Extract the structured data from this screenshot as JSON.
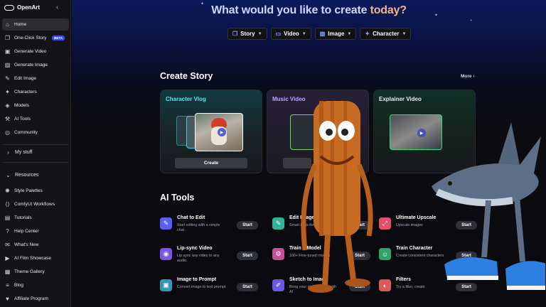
{
  "sidebar": {
    "brand": "OpenArt",
    "items": [
      {
        "label": "Home",
        "icon": "home-icon",
        "glyph": "⌂"
      },
      {
        "label": "One-Click Story",
        "icon": "story-icon",
        "glyph": "❐",
        "badge": "BETA"
      },
      {
        "label": "Generate Video",
        "icon": "video-icon",
        "glyph": "▣"
      },
      {
        "label": "Generate Image",
        "icon": "image-icon",
        "glyph": "▨"
      },
      {
        "label": "Edit Image",
        "icon": "edit-icon",
        "glyph": "✎"
      },
      {
        "label": "Characters",
        "icon": "character-icon",
        "glyph": "✦"
      },
      {
        "label": "Models",
        "icon": "models-icon",
        "glyph": "◈"
      },
      {
        "label": "AI Tools",
        "icon": "tools-icon",
        "glyph": "⚒"
      },
      {
        "label": "Community",
        "icon": "community-icon",
        "glyph": "◎"
      }
    ],
    "my_stuff": "My stuff",
    "resources": "Resources",
    "resource_items": [
      {
        "label": "Style Palettes",
        "icon": "palette-icon",
        "glyph": "✺"
      },
      {
        "label": "ComfyUI Workflows",
        "icon": "code-icon",
        "glyph": "⟨⟩"
      },
      {
        "label": "Tutorials",
        "icon": "tutorials-icon",
        "glyph": "▤"
      },
      {
        "label": "Help Center",
        "icon": "help-icon",
        "glyph": "?"
      },
      {
        "label": "What's New",
        "icon": "megaphone-icon",
        "glyph": "✉"
      },
      {
        "label": "AI Film Showcase",
        "icon": "film-icon",
        "glyph": "▶"
      },
      {
        "label": "Theme Gallery",
        "icon": "gallery-icon",
        "glyph": "▦"
      },
      {
        "label": "Blog",
        "icon": "blog-icon",
        "glyph": "≡"
      },
      {
        "label": "Affiliate Program",
        "icon": "affiliate-icon",
        "glyph": "♥"
      }
    ]
  },
  "header": {
    "headline_part1": "What would you like to create",
    "headline_part2": "today?",
    "filters": [
      {
        "label": "Story",
        "icon": "story-filter-icon",
        "glyph": "❐"
      },
      {
        "label": "Video",
        "icon": "video-filter-icon",
        "glyph": "▭"
      },
      {
        "label": "Image",
        "icon": "image-filter-icon",
        "glyph": "▨"
      },
      {
        "label": "Character",
        "icon": "character-filter-icon",
        "glyph": "✦"
      }
    ]
  },
  "create_story": {
    "title": "Create Story",
    "more": "More ›",
    "cards": [
      {
        "title": "Character Vlog",
        "title_color": "#5fe3f0",
        "button": "Create",
        "bg": "#1a2a30"
      },
      {
        "title": "Music Video",
        "title_color": "#b9a6ff",
        "button": "",
        "bg": "#1c1a28"
      },
      {
        "title": "Explainer Video",
        "title_color": "#e8e8ec",
        "button": "",
        "bg": "#132420"
      }
    ]
  },
  "ai_tools": {
    "title": "AI Tools",
    "start_label": "Start",
    "tools": [
      {
        "name": "Chat to Edit",
        "desc": "Start editing with a simple chat",
        "icon": "chat-edit-icon",
        "glyph": "✎",
        "color": "#5a5ff0"
      },
      {
        "name": "Edit Image",
        "desc": "Smart tools for image editing",
        "icon": "edit-image-icon",
        "glyph": "✎",
        "color": "#2fb39a"
      },
      {
        "name": "Ultimate Upscale",
        "desc": "Upscale images",
        "icon": "upscale-icon",
        "glyph": "⤢",
        "color": "#e0506a"
      },
      {
        "name": "Lip-sync Video",
        "desc": "Lip sync any video to any audio.",
        "icon": "lipsync-icon",
        "glyph": "◉",
        "color": "#7a55e8"
      },
      {
        "name": "Train a Model",
        "desc": "100+ Fine-tuned models",
        "icon": "train-model-icon",
        "glyph": "⚙",
        "color": "#c8509a"
      },
      {
        "name": "Train Character",
        "desc": "Create consistent characters",
        "icon": "train-character-icon",
        "glyph": "☺",
        "color": "#2fa36a"
      },
      {
        "name": "Image to Prompt",
        "desc": "Convert image to text prompt",
        "icon": "image-prompt-icon",
        "glyph": "▣",
        "color": "#2f9ab0"
      },
      {
        "name": "Sketch to Image",
        "desc": "Bring your sketch to life with AI",
        "icon": "sketch-icon",
        "glyph": "✐",
        "color": "#6a58e0"
      },
      {
        "name": "Filters",
        "desc": "Try a filter, create",
        "icon": "filter-icon",
        "glyph": "◐",
        "color": "#d85a5a"
      }
    ]
  }
}
